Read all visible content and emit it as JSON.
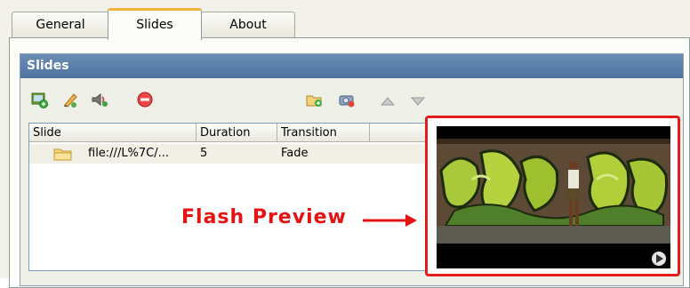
{
  "tabs": [
    {
      "label": "General",
      "active": false
    },
    {
      "label": "Slides",
      "active": true
    },
    {
      "label": "About",
      "active": false
    }
  ],
  "group": {
    "title": "Slides"
  },
  "toolbar": {
    "icons": [
      "add-slide-icon",
      "edit-slide-icon",
      "sound-icon",
      "remove-slide-icon",
      "add-folder-icon",
      "camera-icon",
      "move-up-icon",
      "move-down-icon"
    ]
  },
  "slides_list": {
    "columns": [
      "Slide",
      "Duration",
      "Transition"
    ],
    "rows": [
      {
        "slide": "file:///L%7C/...",
        "duration": "5",
        "transition": "Fade"
      }
    ]
  },
  "annotation": {
    "label": "Flash Preview",
    "color": "#e41212"
  },
  "colors": {
    "header_blue": "#5b7fad",
    "accent_tab": "#f4b43a",
    "highlight_red": "#e21b1b"
  }
}
